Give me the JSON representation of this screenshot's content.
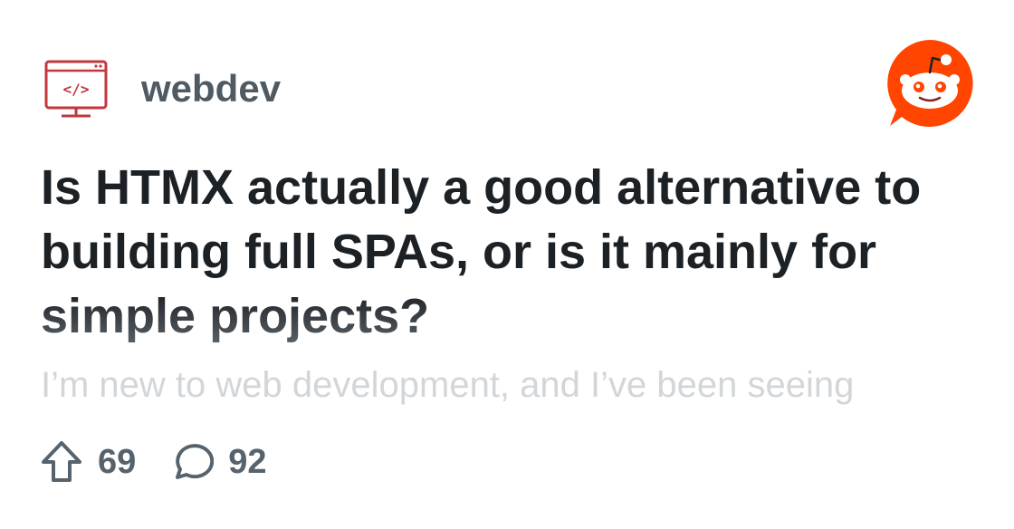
{
  "subreddit": {
    "name": "webdev",
    "icon": "monitor-code-icon",
    "icon_color": "#c2373e"
  },
  "brand": {
    "icon": "reddit-logo",
    "color": "#ff4500"
  },
  "post": {
    "title": "Is HTMX actually a good alternative to building full SPAs, or is it mainly for simple projects?",
    "body_preview": "I’m new to web development, and I’ve been seeing"
  },
  "stats": {
    "upvotes": "69",
    "upvote_icon": "upvote-arrow-icon",
    "comments": "92",
    "comment_icon": "comment-bubble-icon"
  }
}
